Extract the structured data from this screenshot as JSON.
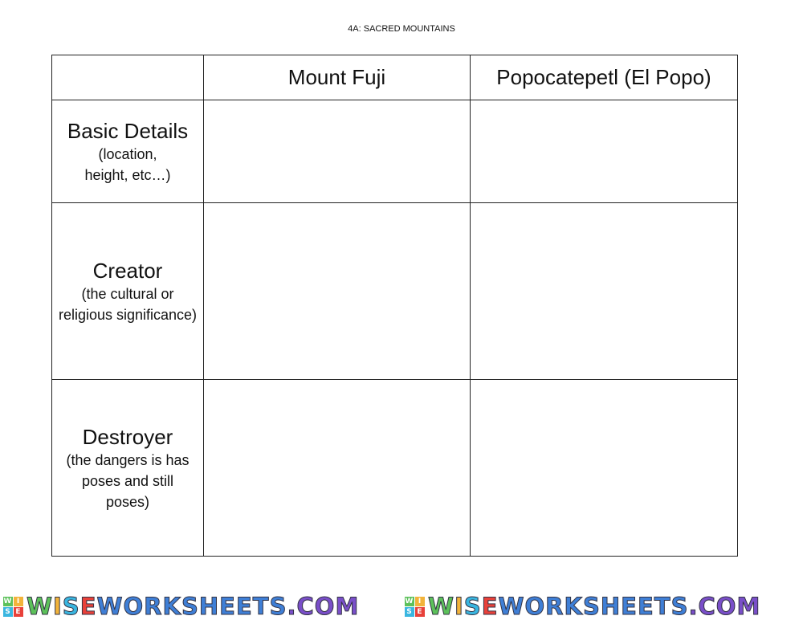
{
  "document": {
    "title": "4A: SACRED MOUNTAINS"
  },
  "table": {
    "headers": [
      "",
      "Mount Fuji",
      "Popocatepetl (El Popo)"
    ],
    "rows": [
      {
        "label": "Basic Details",
        "sub": "(location, height, etc…)"
      },
      {
        "label": "Creator",
        "sub": "(the cultural or religious significance)"
      },
      {
        "label": "Destroyer",
        "sub": "(the dangers is has poses and still poses)"
      }
    ]
  },
  "watermark": {
    "text": "WISEWORKSHEETS.COM",
    "badge": [
      "W",
      "I",
      "S",
      "E"
    ],
    "colors": {
      "W": "#5cc15a",
      "I": "#f2b33a",
      "S": "#3ab6e0",
      "E": "#e8413a",
      "WORKSHEETS": "#3f7fd6",
      "COM": "#7a4fc9"
    }
  }
}
